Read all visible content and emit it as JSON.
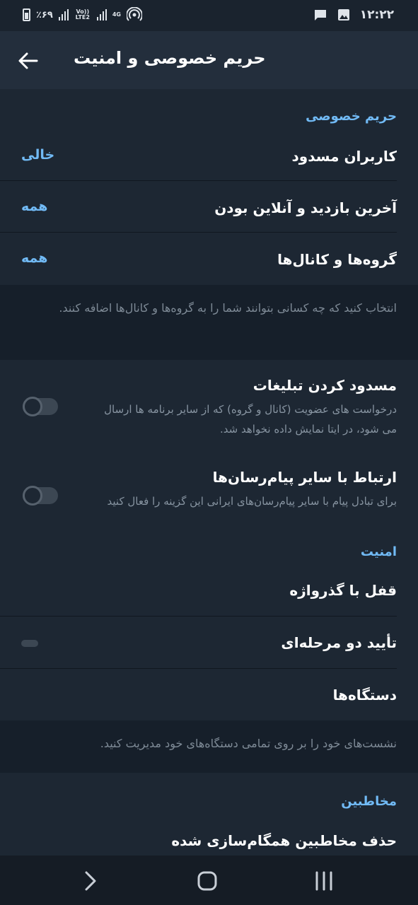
{
  "status_bar": {
    "time": "۱۲:۲۲",
    "battery": "٪۶۹",
    "network_volte": "Vo)) LTE2",
    "network_4g": "4G"
  },
  "app_bar": {
    "title": "حریم خصوصی و امنیت"
  },
  "privacy": {
    "header": "حریم خصوصی",
    "blocked_users": {
      "label": "کاربران مسدود",
      "value": "خالی"
    },
    "last_seen": {
      "label": "آخرین بازدید و آنلاین بودن",
      "value": "همه"
    },
    "groups_channels": {
      "label": "گروه‌ها و کانال‌ها",
      "value": "همه"
    },
    "info": "انتخاب کنید که چه کسانی بتوانند شما را به گروه‌ها و کانال‌ها اضافه کنند."
  },
  "ads": {
    "block_ads": {
      "label": "مسدود کردن تبلیغات",
      "line1": "درخواست های عضویت (کانال و گروه) که از سایر برنامه ها ارسال",
      "line2": "می شود، در ایتا نمایش داده نخواهد شد.",
      "enabled": false
    },
    "other_messengers": {
      "label": "ارتباط با سایر پیام‌رسان‌ها",
      "line1": "برای تبادل پیام با سایر پیام‌رسان‌های ایرانی این گزینه را فعال کنید",
      "enabled": false
    }
  },
  "security": {
    "header": "امنیت",
    "passcode": {
      "label": "قفل با گذرواژه"
    },
    "two_step": {
      "label": "تأیید دو مرحله‌ای"
    },
    "devices": {
      "label": "دستگاه‌ها"
    },
    "info": "نشست‌های خود را بر روی تمامی دستگاه‌های خود مدیریت کنید."
  },
  "contacts": {
    "header": "مخاطبین",
    "delete_synced": {
      "label": "حذف مخاطبین همگام‌سازی شده"
    }
  },
  "colors": {
    "accent": "#71baf5",
    "background": "#1d2733",
    "app_bar": "#232e3c",
    "info_background": "#161f2a"
  },
  "icons": {
    "back": "arrow-left-icon",
    "nav_back": "chevron-right-icon",
    "nav_home": "home-square-icon",
    "nav_recents": "recents-lines-icon"
  }
}
